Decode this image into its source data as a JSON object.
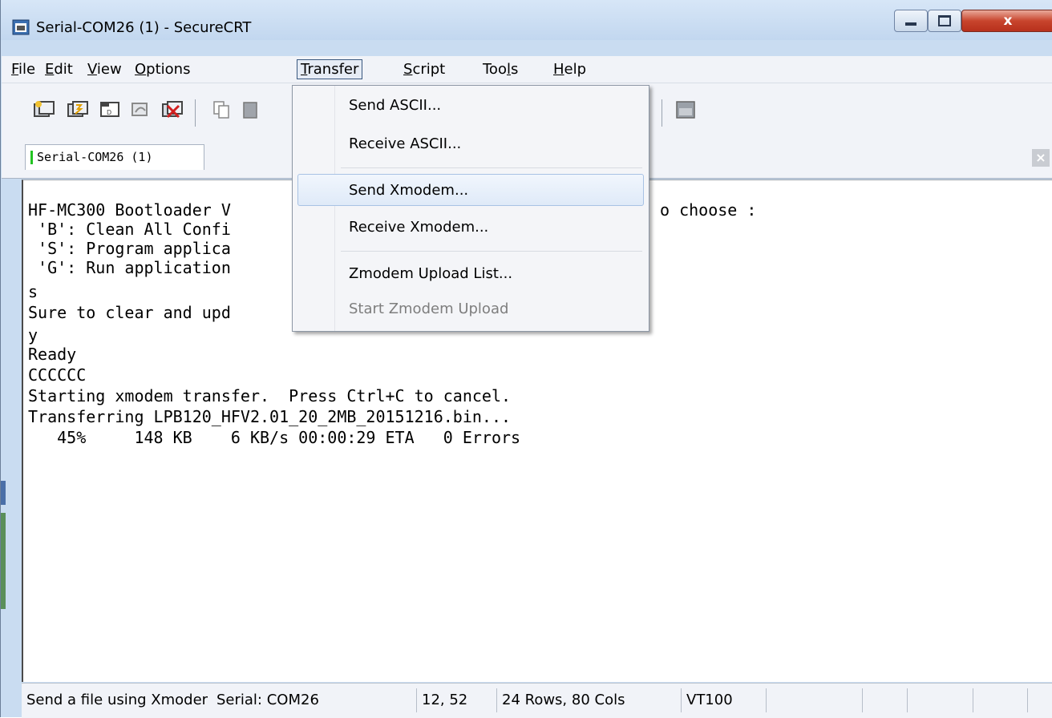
{
  "window": {
    "title": "Serial-COM26 (1) - SecureCRT",
    "close_glyph": "x"
  },
  "menubar": {
    "items": [
      {
        "label_u": "F",
        "label_rest": "ile"
      },
      {
        "label_u": "E",
        "label_rest": "dit"
      },
      {
        "label_u": "V",
        "label_rest": "iew"
      },
      {
        "label_u": "O",
        "label_rest": "ptions"
      },
      {
        "label_u": "T",
        "label_rest": "ransfer"
      },
      {
        "label_u": "S",
        "label_rest": "cript"
      },
      {
        "label_pre": "Too",
        "label_u": "l",
        "label_rest": "s"
      },
      {
        "label_u": "H",
        "label_rest": "elp"
      }
    ],
    "active": "Transfer"
  },
  "toolbar": {
    "icons": [
      "connect-icon",
      "quick-connect-icon",
      "connect-tab-icon",
      "reconnect-icon",
      "disconnect-icon",
      "copy-icon",
      "paste-icon",
      "keymap-icon"
    ]
  },
  "tabs": [
    {
      "label": "Serial-COM26 (1)",
      "status_color": "#22c322"
    }
  ],
  "tab_close_glyph": "×",
  "terminal": {
    "lines": [
      "HF-MC300 Bootloader V",
      " 'B': Clean All Confi",
      " 'S': Program applica",
      " 'G': Run application",
      "s",
      "Sure to clear and upd",
      "y",
      "Ready",
      "CCCCCC",
      "Starting xmodem transfer.  Press Ctrl+C to cancel.",
      "Transferring LPB120_HFV2.01_20_2MB_20151216.bin...",
      "   45%     148 KB    6 KB/s 00:00:29 ETA   0 Errors"
    ],
    "partial_line_right": "o choose :"
  },
  "transfer_menu": {
    "items": [
      {
        "label": "Send ASCII...",
        "enabled": true
      },
      {
        "label": "Receive ASCII...",
        "enabled": true
      },
      {
        "label": "Send Xmodem...",
        "enabled": true,
        "highlighted": true
      },
      {
        "label": "Receive Xmodem...",
        "enabled": true
      },
      {
        "label": "Zmodem Upload List...",
        "enabled": true
      },
      {
        "label": "Start Zmodem Upload",
        "enabled": false
      }
    ]
  },
  "statusbar": {
    "cells": [
      "Send a file using Xmoder",
      "Serial: COM26",
      "12,  52",
      "24 Rows,  80 Cols",
      "VT100",
      "",
      "",
      "",
      ""
    ]
  },
  "colors": {
    "title_bar": "#c9dcf1",
    "close_button": "#c8452d",
    "menu_highlight": "#dfeaf8",
    "terminal_bg": "#ffffff"
  }
}
